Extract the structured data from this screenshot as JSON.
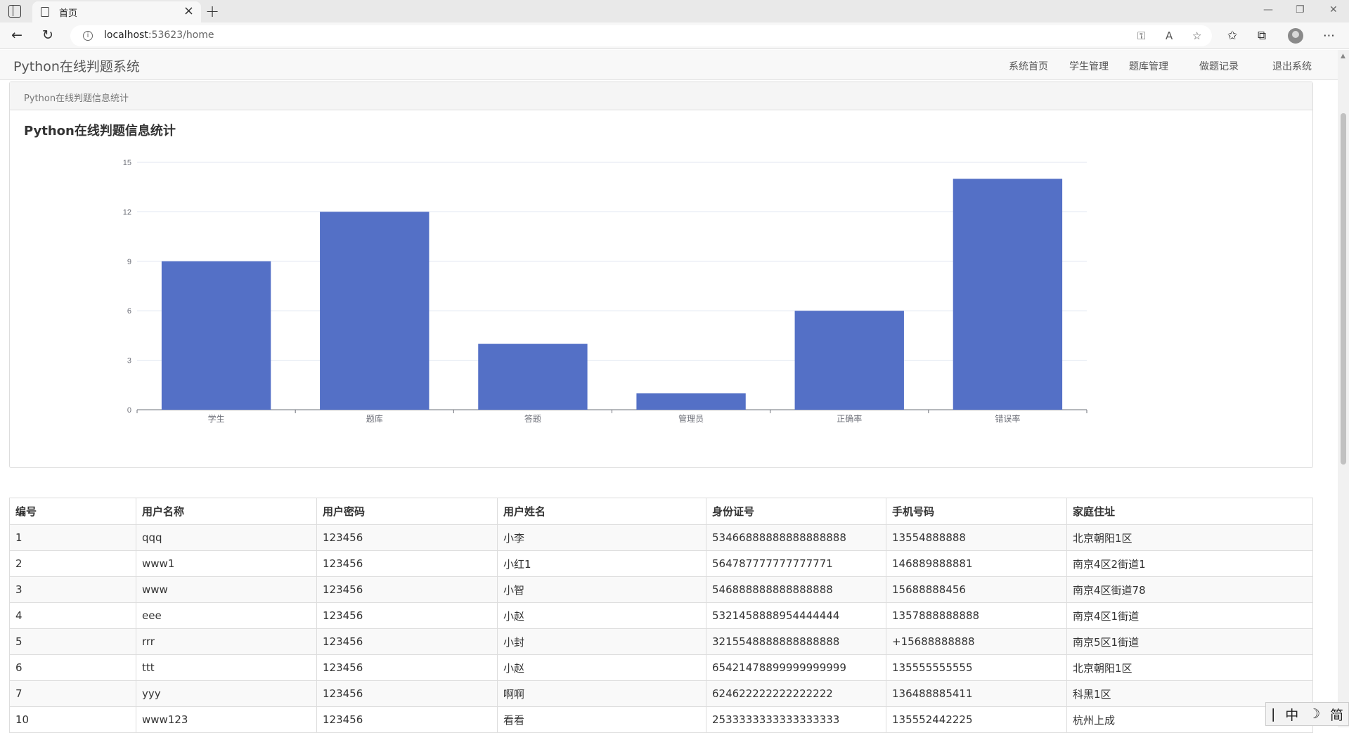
{
  "browser": {
    "tab_title": "首页",
    "url_host": "localhost",
    "url_rest": ":53623/home"
  },
  "navbar": {
    "brand": "Python在线判题系统",
    "menu": [
      {
        "label": "系统首页"
      },
      {
        "label": "学生管理"
      },
      {
        "label": "题库管理"
      },
      {
        "label": "做题记录"
      },
      {
        "label": "退出系统"
      }
    ]
  },
  "panel": {
    "heading": "Python在线判题信息统计",
    "chart_title": "Python在线判题信息统计"
  },
  "chart_data": {
    "type": "bar",
    "title": "Python在线判题信息统计",
    "categories": [
      "学生",
      "题库",
      "答题",
      "管理员",
      "正确率",
      "错误率"
    ],
    "values": [
      9,
      12,
      4,
      1,
      6,
      14
    ],
    "ylim": [
      0,
      15
    ],
    "yticks": [
      0,
      3,
      6,
      9,
      12,
      15
    ],
    "grid": true,
    "bar_color": "#5470c6"
  },
  "table": {
    "headers": [
      "编号",
      "用户名称",
      "用户密码",
      "用户姓名",
      "身份证号",
      "手机号码",
      "家庭住址"
    ],
    "rows": [
      [
        "1",
        "qqq",
        "123456",
        "小李",
        "53466888888888888888",
        "13554888888",
        "北京朝阳1区"
      ],
      [
        "2",
        "www1",
        "123456",
        "小红1",
        "564787777777777771",
        "146889888881",
        "南京4区2街道1"
      ],
      [
        "3",
        "www",
        "123456",
        "小智",
        "546888888888888888",
        "15688888456",
        "南京4区街道78"
      ],
      [
        "4",
        "eee",
        "123456",
        "小赵",
        "5321458888954444444",
        "1357888888888",
        "南京4区1街道"
      ],
      [
        "5",
        "rrr",
        "123456",
        "小封",
        "3215548888888888888",
        "+15688888888",
        "南京5区1街道"
      ],
      [
        "6",
        "ttt",
        "123456",
        "小赵",
        "65421478899999999999",
        "135555555555",
        "北京朝阳1区"
      ],
      [
        "7",
        "yyy",
        "123456",
        "啊啊",
        "624622222222222222",
        "136488885411",
        "科黑1区"
      ],
      [
        "10",
        "www123",
        "123456",
        "看看",
        "2533333333333333333",
        "135552442225",
        "杭州上成"
      ]
    ]
  },
  "ime": {
    "cursor": "|",
    "mode": "中",
    "moon": "☽",
    "script": "简"
  }
}
